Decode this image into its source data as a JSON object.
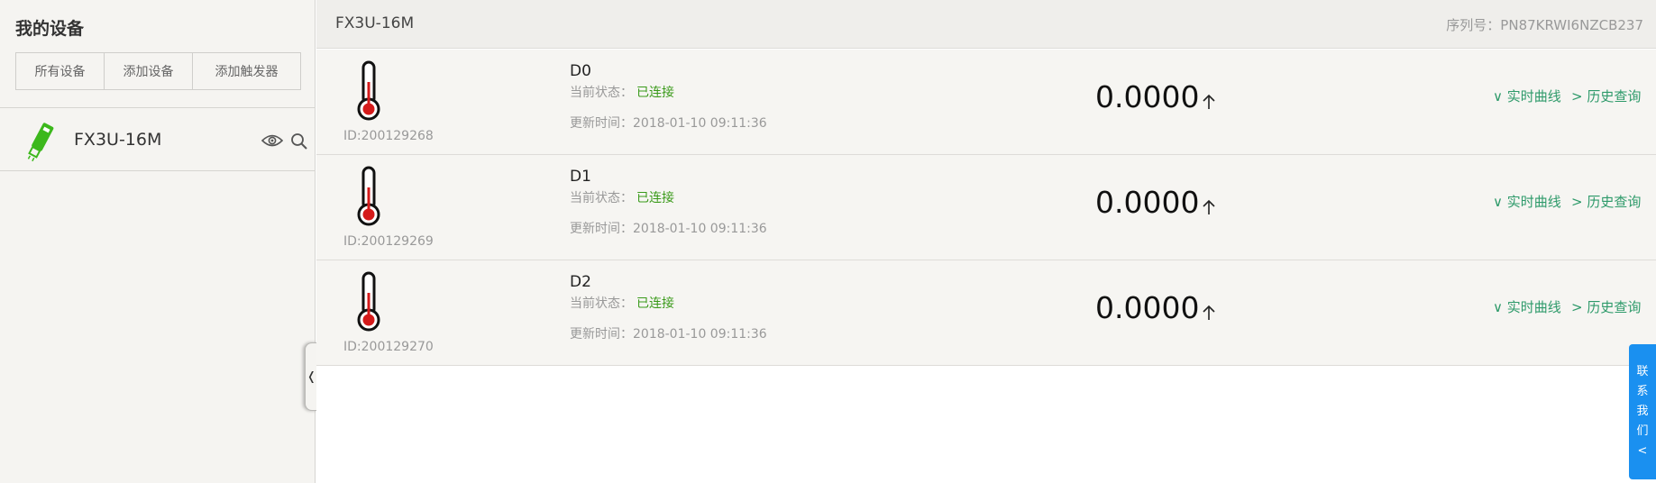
{
  "sidebar": {
    "title": "我的设备",
    "filters": [
      "所有设备",
      "添加设备",
      "添加触发器"
    ],
    "device": {
      "name": "FX3U-16M",
      "icon": "usb-stick-icon"
    },
    "collapse_label": "❬"
  },
  "header": {
    "title": "FX3U-16M",
    "serial": "序列号：PN87KRWI6NZCB237"
  },
  "rows": [
    {
      "name": "D0",
      "id": "ID:200129268",
      "status_label": "当前状态：",
      "status": "已连接",
      "time": "更新时间：2018-01-10 09:11:36",
      "value": "0.0000",
      "realtime_link": "∨ 实时曲线",
      "history_link": "> 历史查询"
    },
    {
      "name": "D1",
      "id": "ID:200129269",
      "status_label": "当前状态：",
      "status": "已连接",
      "time": "更新时间：2018-01-10 09:11:36",
      "value": "0.0000",
      "realtime_link": "∨ 实时曲线",
      "history_link": "> 历史查询"
    },
    {
      "name": "D2",
      "id": "ID:200129270",
      "status_label": "当前状态：",
      "status": "已连接",
      "time": "更新时间：2018-01-10 09:11:36",
      "value": "0.0000",
      "realtime_link": "∨ 实时曲线",
      "history_link": "> 历史查询"
    }
  ],
  "contact": {
    "chars": [
      "联",
      "系",
      "我",
      "们",
      "<"
    ]
  },
  "colors": {
    "status_ok": "#3a9a1a",
    "link": "#2e9a6a",
    "contact_bg": "#1a90f0",
    "device_icon": "#3cb81c"
  }
}
